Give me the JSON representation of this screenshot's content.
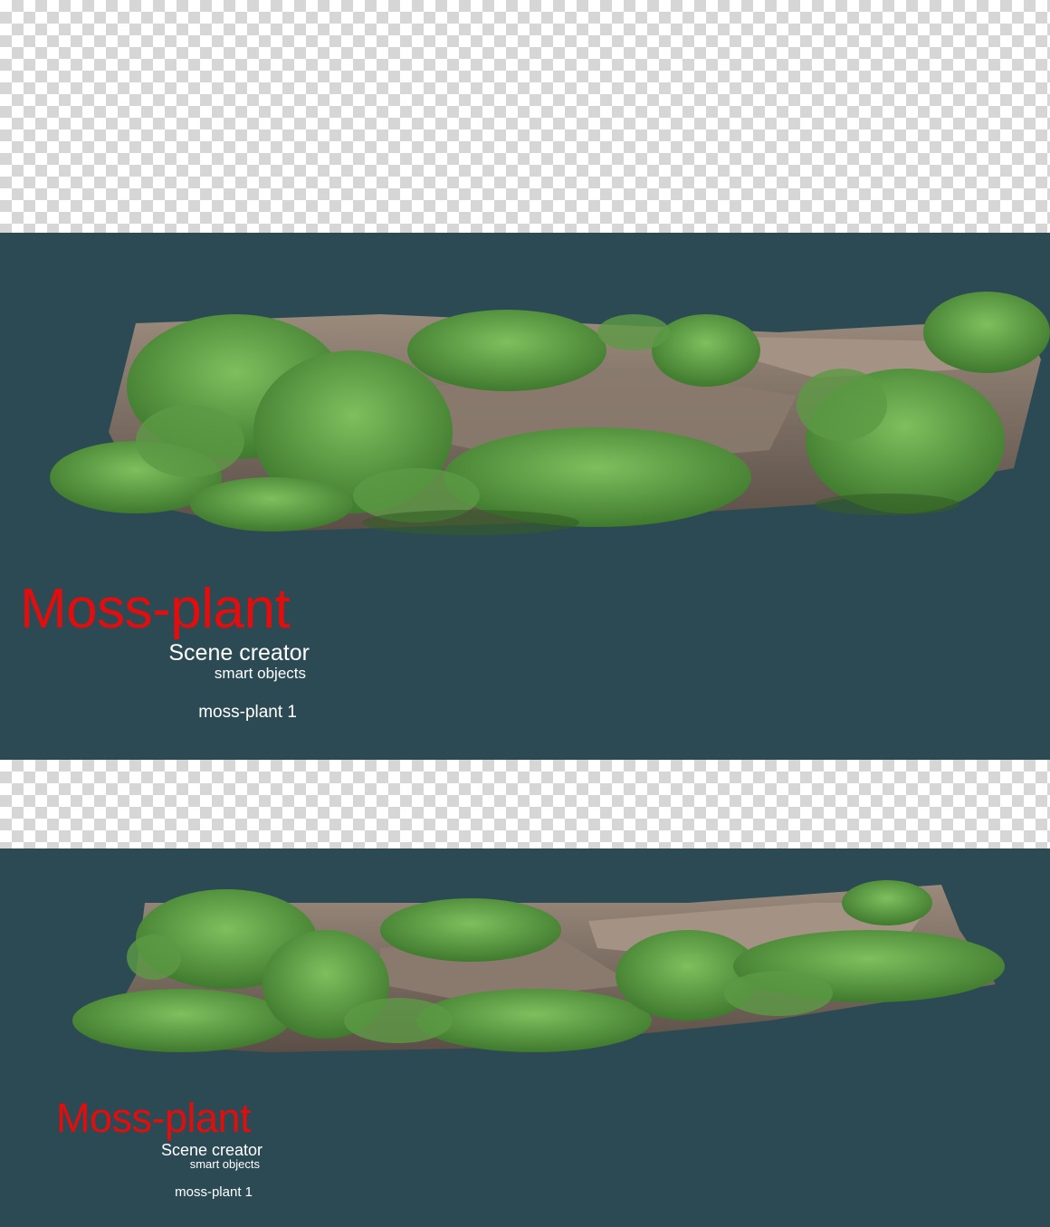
{
  "panels": [
    {
      "title": "Moss-plant",
      "subtitle": "Scene creator",
      "subtitle_small": "smart objects",
      "caption": "moss-plant 1"
    },
    {
      "title": "Moss-plant",
      "subtitle": "Scene creator",
      "subtitle_small": "smart objects",
      "caption": "moss-plant 1"
    }
  ],
  "colors": {
    "panel_background": "#2c4a54",
    "title_red": "#e30d0d",
    "moss_green": "#4f8a3a",
    "bark": "#7a6c62"
  }
}
